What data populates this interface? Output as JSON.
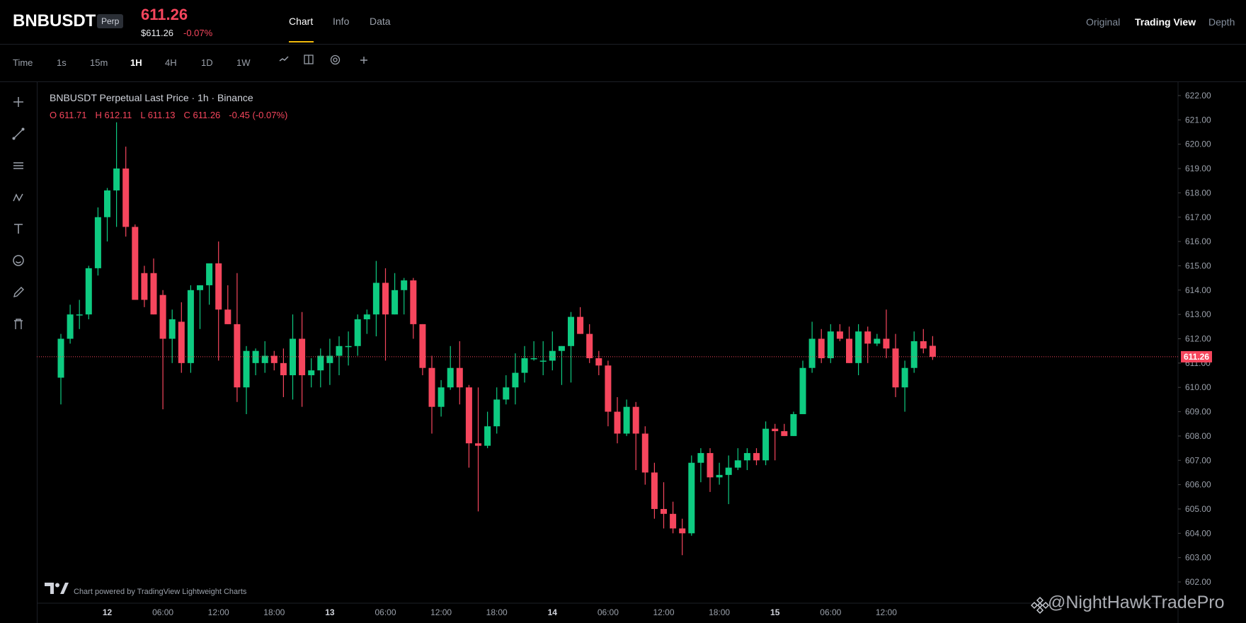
{
  "header": {
    "symbol": "BNBUSDT",
    "badge": "Perp",
    "last_price": "611.26",
    "mark_price": "$611.26",
    "change_pct": "-0.07%",
    "tabs": [
      {
        "label": "Chart"
      },
      {
        "label": "Info"
      },
      {
        "label": "Data"
      }
    ],
    "views": [
      {
        "label": "Original"
      },
      {
        "label": "Trading View"
      },
      {
        "label": "Depth"
      }
    ]
  },
  "toolbar": {
    "time_label": "Time",
    "intervals": [
      "1s",
      "15m",
      "1H",
      "4H",
      "1D",
      "1W"
    ],
    "active_interval": "1H",
    "icons": [
      "line-style-icon",
      "columns-icon",
      "indicator-icon",
      "plus-icon"
    ]
  },
  "left_tools": [
    "crosshair-icon",
    "trendline-icon",
    "horizontal-lines-icon",
    "wave-icon",
    "text-icon",
    "emoji-icon",
    "pencil-icon",
    "trash-icon"
  ],
  "legend": {
    "title": "BNBUSDT Perpetual Last Price · 1h · Binance",
    "open": "O 611.71",
    "high": "H 612.11",
    "low": "L 611.13",
    "close": "C 611.26",
    "change": "-0.45 (-0.07%)"
  },
  "watermark": {
    "text": "Chart powered by TradingView Lightweight Charts",
    "handle": "@NightHawkTradePro"
  },
  "colors": {
    "up": "#0ecb81",
    "down": "#f6465d",
    "accent": "#f0b90b",
    "last_price_line": "#f6465d"
  },
  "chart_data": {
    "type": "candlestick",
    "title": "BNBUSDT Perpetual Last Price · 1h · Binance",
    "ylim": [
      601.5,
      622.5
    ],
    "y_ticks": [
      "622.00",
      "621.00",
      "620.00",
      "619.00",
      "618.00",
      "617.00",
      "616.00",
      "615.00",
      "614.00",
      "613.00",
      "612.00",
      "611.00",
      "610.00",
      "609.00",
      "608.00",
      "607.00",
      "606.00",
      "605.00",
      "604.00",
      "603.00",
      "602.00"
    ],
    "last_price_label": "611.26",
    "last_price": 611.26,
    "x_ticks": [
      {
        "label": "12",
        "bar": 5
      },
      {
        "label": "06:00",
        "bar": 11
      },
      {
        "label": "12:00",
        "bar": 17
      },
      {
        "label": "18:00",
        "bar": 23
      },
      {
        "label": "13",
        "bar": 29
      },
      {
        "label": "06:00",
        "bar": 35
      },
      {
        "label": "12:00",
        "bar": 41
      },
      {
        "label": "18:00",
        "bar": 47
      },
      {
        "label": "14",
        "bar": 53
      },
      {
        "label": "06:00",
        "bar": 59
      },
      {
        "label": "12:00",
        "bar": 65
      },
      {
        "label": "18:00",
        "bar": 71
      },
      {
        "label": "15",
        "bar": 77
      },
      {
        "label": "06:00",
        "bar": 83
      },
      {
        "label": "12:00",
        "bar": 89
      }
    ],
    "x_bold_labels": [
      "12",
      "13",
      "14",
      "15"
    ],
    "candles": [
      {
        "o": 610.4,
        "h": 612.2,
        "l": 609.3,
        "c": 612.0
      },
      {
        "o": 612.0,
        "h": 613.4,
        "l": 611.8,
        "c": 613.0
      },
      {
        "o": 613.0,
        "h": 613.6,
        "l": 612.4,
        "c": 613.0
      },
      {
        "o": 613.0,
        "h": 615.0,
        "l": 612.8,
        "c": 614.9
      },
      {
        "o": 614.9,
        "h": 617.4,
        "l": 614.6,
        "c": 617.0
      },
      {
        "o": 617.0,
        "h": 618.2,
        "l": 616.0,
        "c": 618.1
      },
      {
        "o": 618.1,
        "h": 620.9,
        "l": 616.6,
        "c": 619.0
      },
      {
        "o": 619.0,
        "h": 619.9,
        "l": 616.2,
        "c": 616.6
      },
      {
        "o": 616.6,
        "h": 616.7,
        "l": 613.8,
        "c": 613.6
      },
      {
        "o": 614.7,
        "h": 615.0,
        "l": 613.3,
        "c": 613.6
      },
      {
        "o": 614.7,
        "h": 615.3,
        "l": 613.0,
        "c": 613.0
      },
      {
        "o": 613.8,
        "h": 614.0,
        "l": 609.1,
        "c": 612.0
      },
      {
        "o": 612.0,
        "h": 613.2,
        "l": 611.0,
        "c": 612.8
      },
      {
        "o": 612.7,
        "h": 613.5,
        "l": 610.6,
        "c": 611.0
      },
      {
        "o": 611.0,
        "h": 614.2,
        "l": 610.6,
        "c": 614.0
      },
      {
        "o": 614.0,
        "h": 614.2,
        "l": 612.4,
        "c": 614.2
      },
      {
        "o": 614.2,
        "h": 615.1,
        "l": 613.4,
        "c": 615.1
      },
      {
        "o": 615.1,
        "h": 616.0,
        "l": 611.1,
        "c": 613.2
      },
      {
        "o": 613.2,
        "h": 614.2,
        "l": 612.6,
        "c": 612.6
      },
      {
        "o": 612.6,
        "h": 614.7,
        "l": 609.4,
        "c": 610.0
      },
      {
        "o": 610.0,
        "h": 611.7,
        "l": 608.9,
        "c": 611.5
      },
      {
        "o": 611.0,
        "h": 611.6,
        "l": 610.5,
        "c": 611.5
      },
      {
        "o": 611.0,
        "h": 611.9,
        "l": 610.6,
        "c": 611.3
      },
      {
        "o": 611.3,
        "h": 611.5,
        "l": 610.7,
        "c": 611.0
      },
      {
        "o": 611.0,
        "h": 611.6,
        "l": 609.6,
        "c": 610.5
      },
      {
        "o": 610.5,
        "h": 613.0,
        "l": 609.5,
        "c": 612.0
      },
      {
        "o": 612.0,
        "h": 613.1,
        "l": 609.2,
        "c": 610.5
      },
      {
        "o": 610.5,
        "h": 611.2,
        "l": 610.0,
        "c": 610.7
      },
      {
        "o": 610.7,
        "h": 611.6,
        "l": 610.0,
        "c": 611.3
      },
      {
        "o": 611.0,
        "h": 612.0,
        "l": 610.1,
        "c": 611.3
      },
      {
        "o": 611.3,
        "h": 612.1,
        "l": 610.5,
        "c": 611.7
      },
      {
        "o": 611.7,
        "h": 612.3,
        "l": 610.9,
        "c": 611.7
      },
      {
        "o": 611.7,
        "h": 613.0,
        "l": 611.3,
        "c": 612.8
      },
      {
        "o": 612.8,
        "h": 613.2,
        "l": 612.2,
        "c": 613.0
      },
      {
        "o": 613.0,
        "h": 615.2,
        "l": 612.1,
        "c": 614.3
      },
      {
        "o": 614.3,
        "h": 614.9,
        "l": 611.1,
        "c": 613.0
      },
      {
        "o": 613.0,
        "h": 614.7,
        "l": 613.0,
        "c": 614.0
      },
      {
        "o": 614.0,
        "h": 614.5,
        "l": 613.0,
        "c": 614.4
      },
      {
        "o": 614.4,
        "h": 614.5,
        "l": 612.0,
        "c": 612.6
      },
      {
        "o": 612.6,
        "h": 612.6,
        "l": 610.5,
        "c": 610.8
      },
      {
        "o": 610.8,
        "h": 611.3,
        "l": 608.1,
        "c": 609.2
      },
      {
        "o": 609.2,
        "h": 610.3,
        "l": 608.8,
        "c": 610.0
      },
      {
        "o": 610.0,
        "h": 611.7,
        "l": 609.9,
        "c": 610.8
      },
      {
        "o": 610.8,
        "h": 611.9,
        "l": 609.3,
        "c": 610.0
      },
      {
        "o": 610.0,
        "h": 610.1,
        "l": 606.7,
        "c": 607.7
      },
      {
        "o": 607.7,
        "h": 610.0,
        "l": 604.9,
        "c": 607.6
      },
      {
        "o": 607.6,
        "h": 609.0,
        "l": 607.5,
        "c": 608.4
      },
      {
        "o": 608.4,
        "h": 610.0,
        "l": 608.1,
        "c": 609.5
      },
      {
        "o": 609.5,
        "h": 610.5,
        "l": 609.3,
        "c": 610.0
      },
      {
        "o": 610.0,
        "h": 611.4,
        "l": 609.3,
        "c": 610.6
      },
      {
        "o": 610.6,
        "h": 611.7,
        "l": 610.2,
        "c": 611.2
      },
      {
        "o": 611.2,
        "h": 611.9,
        "l": 611.1,
        "c": 611.2
      },
      {
        "o": 611.1,
        "h": 611.9,
        "l": 610.5,
        "c": 611.1
      },
      {
        "o": 611.1,
        "h": 612.3,
        "l": 610.7,
        "c": 611.5
      },
      {
        "o": 611.5,
        "h": 611.7,
        "l": 610.1,
        "c": 611.7
      },
      {
        "o": 611.7,
        "h": 613.1,
        "l": 610.2,
        "c": 612.9
      },
      {
        "o": 612.9,
        "h": 613.3,
        "l": 612.2,
        "c": 612.2
      },
      {
        "o": 612.2,
        "h": 612.6,
        "l": 611.0,
        "c": 611.2
      },
      {
        "o": 611.2,
        "h": 611.5,
        "l": 610.5,
        "c": 610.9
      },
      {
        "o": 610.9,
        "h": 611.1,
        "l": 608.4,
        "c": 609.0
      },
      {
        "o": 609.0,
        "h": 609.6,
        "l": 607.7,
        "c": 608.1
      },
      {
        "o": 608.1,
        "h": 609.5,
        "l": 608.0,
        "c": 609.2
      },
      {
        "o": 609.2,
        "h": 609.4,
        "l": 606.6,
        "c": 608.1
      },
      {
        "o": 608.1,
        "h": 608.4,
        "l": 606.0,
        "c": 606.5
      },
      {
        "o": 606.5,
        "h": 606.9,
        "l": 604.6,
        "c": 605.0
      },
      {
        "o": 605.0,
        "h": 606.1,
        "l": 604.2,
        "c": 604.8
      },
      {
        "o": 604.8,
        "h": 605.3,
        "l": 604.0,
        "c": 604.2
      },
      {
        "o": 604.2,
        "h": 604.6,
        "l": 603.1,
        "c": 604.0
      },
      {
        "o": 604.0,
        "h": 607.2,
        "l": 603.9,
        "c": 606.9
      },
      {
        "o": 606.9,
        "h": 607.5,
        "l": 606.1,
        "c": 607.3
      },
      {
        "o": 607.3,
        "h": 607.5,
        "l": 605.7,
        "c": 606.3
      },
      {
        "o": 606.3,
        "h": 606.9,
        "l": 606.0,
        "c": 606.4
      },
      {
        "o": 606.4,
        "h": 607.2,
        "l": 605.2,
        "c": 606.7
      },
      {
        "o": 606.7,
        "h": 607.5,
        "l": 606.6,
        "c": 607.0
      },
      {
        "o": 607.0,
        "h": 607.5,
        "l": 606.6,
        "c": 607.3
      },
      {
        "o": 607.3,
        "h": 607.5,
        "l": 606.8,
        "c": 607.0
      },
      {
        "o": 607.0,
        "h": 608.6,
        "l": 606.8,
        "c": 608.3
      },
      {
        "o": 608.3,
        "h": 608.5,
        "l": 607.0,
        "c": 608.2
      },
      {
        "o": 608.2,
        "h": 608.5,
        "l": 608.0,
        "c": 608.0
      },
      {
        "o": 608.0,
        "h": 609.0,
        "l": 608.0,
        "c": 608.9
      },
      {
        "o": 608.9,
        "h": 611.1,
        "l": 608.9,
        "c": 610.8
      },
      {
        "o": 610.8,
        "h": 612.7,
        "l": 610.6,
        "c": 612.0
      },
      {
        "o": 612.0,
        "h": 612.4,
        "l": 611.0,
        "c": 611.2
      },
      {
        "o": 611.2,
        "h": 612.6,
        "l": 611.0,
        "c": 612.3
      },
      {
        "o": 612.3,
        "h": 612.6,
        "l": 611.9,
        "c": 612.0
      },
      {
        "o": 612.0,
        "h": 612.5,
        "l": 611.0,
        "c": 611.0
      },
      {
        "o": 611.0,
        "h": 612.6,
        "l": 610.5,
        "c": 612.3
      },
      {
        "o": 612.3,
        "h": 612.5,
        "l": 611.0,
        "c": 611.8
      },
      {
        "o": 611.8,
        "h": 612.2,
        "l": 611.7,
        "c": 612.0
      },
      {
        "o": 612.0,
        "h": 613.2,
        "l": 611.2,
        "c": 611.6
      },
      {
        "o": 611.6,
        "h": 612.2,
        "l": 609.6,
        "c": 610.0
      },
      {
        "o": 610.0,
        "h": 611.1,
        "l": 609.0,
        "c": 610.8
      },
      {
        "o": 610.8,
        "h": 612.3,
        "l": 610.6,
        "c": 611.9
      },
      {
        "o": 611.9,
        "h": 612.4,
        "l": 611.4,
        "c": 611.6
      },
      {
        "o": 611.71,
        "h": 612.11,
        "l": 611.13,
        "c": 611.26
      }
    ]
  }
}
